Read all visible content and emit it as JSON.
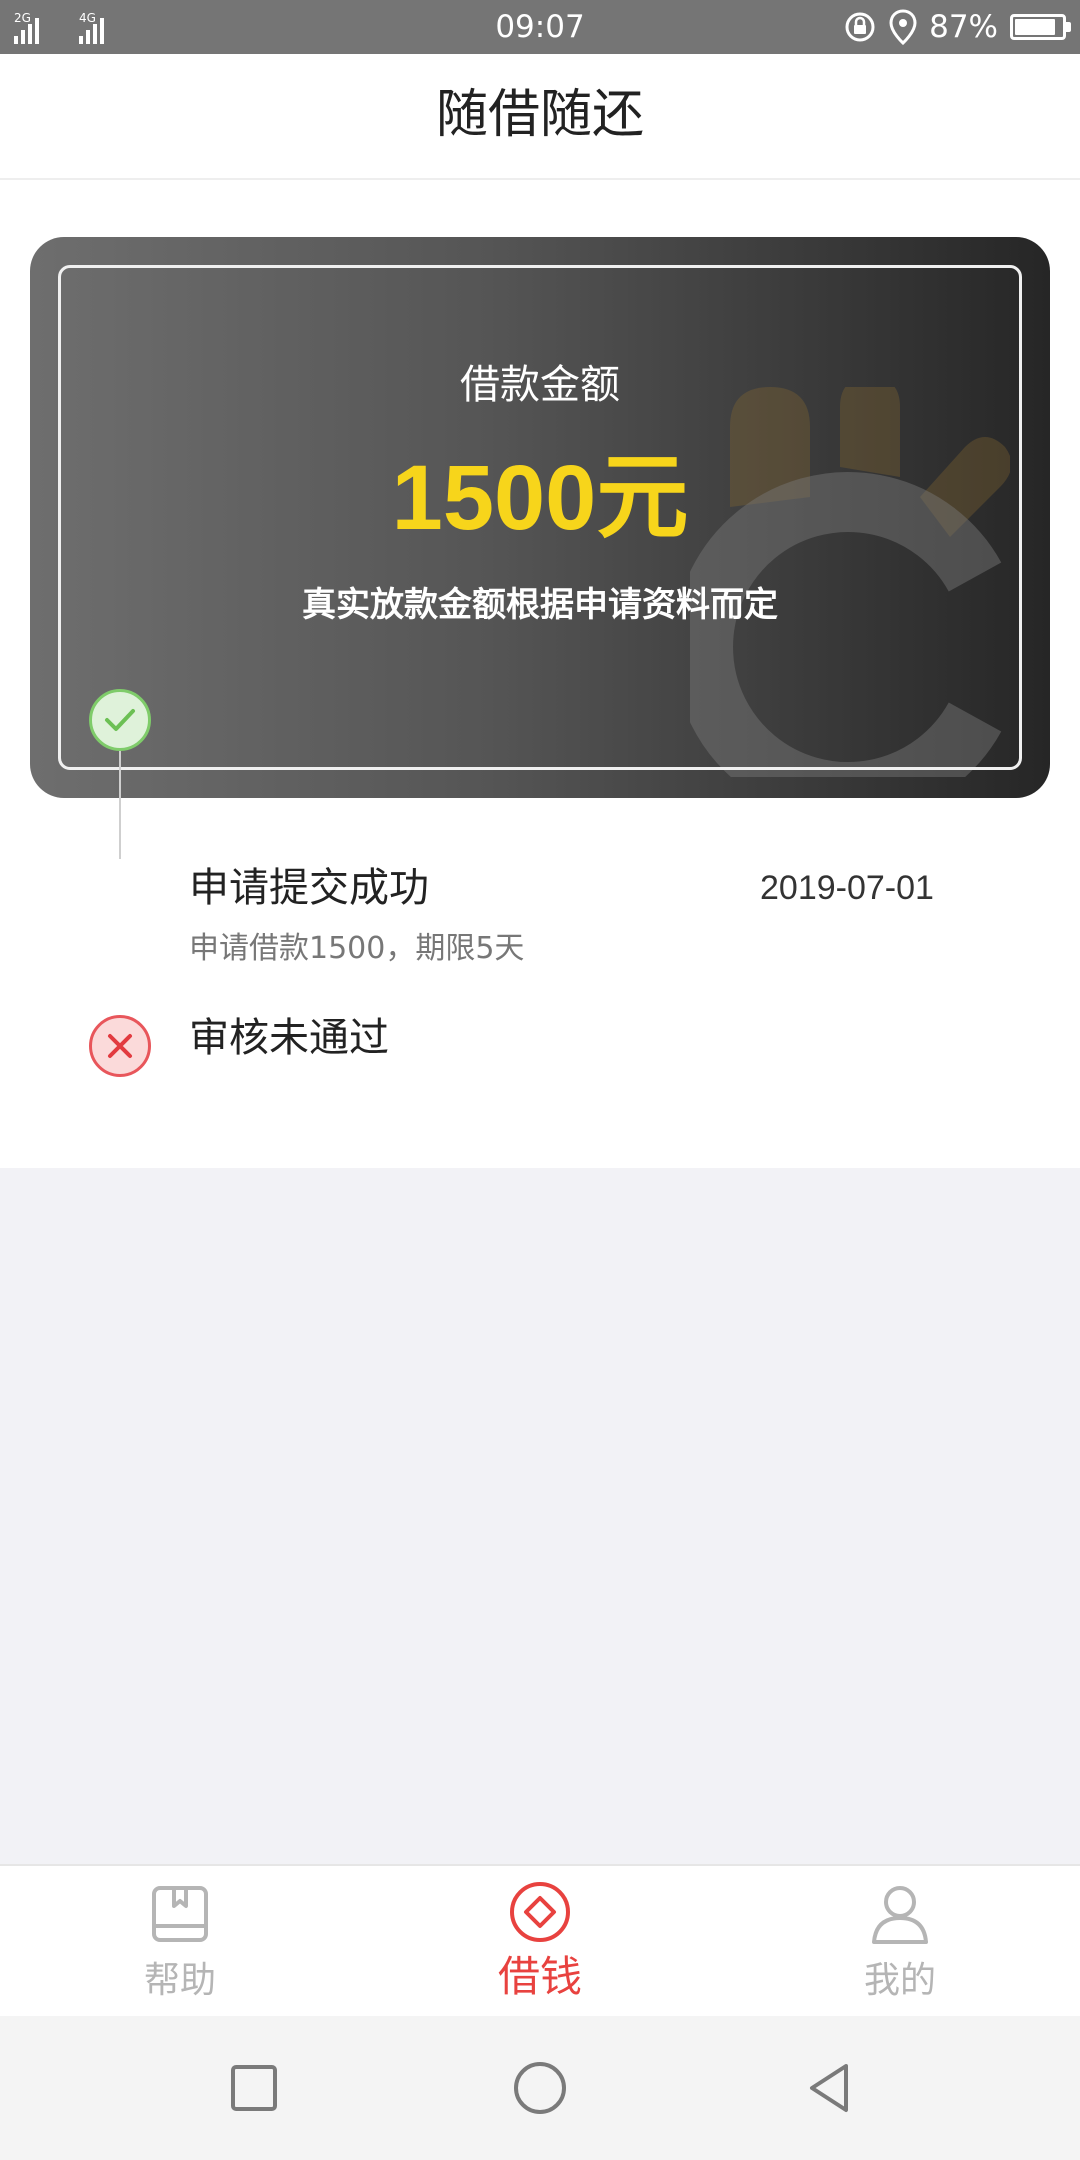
{
  "status_bar": {
    "network_1": "2G",
    "network_2": "4G",
    "time": "09:07",
    "battery_text": "87%",
    "battery_level": 0.87,
    "icons": [
      "rotation-lock-icon",
      "location-icon",
      "battery-icon"
    ]
  },
  "header": {
    "title": "随借随还"
  },
  "loan_card": {
    "label": "借款金额",
    "amount": "1500元",
    "note": "真实放款金额根据申请资料而定",
    "colors": {
      "amount": "#f7d51b",
      "gradient_start": "#6e6e6e",
      "gradient_end": "#262626"
    }
  },
  "timeline": {
    "steps": [
      {
        "title": "申请提交成功",
        "date": "2019-07-01",
        "desc": "申请借款1500，期限5天",
        "status": "success",
        "icon": "check-circle-icon"
      },
      {
        "title": "审核未通过",
        "status": "failed",
        "icon": "x-circle-icon"
      }
    ],
    "colors": {
      "success": "#7fcc6a",
      "failed": "#e8565b"
    }
  },
  "tab_bar": {
    "items": [
      {
        "label": "帮助",
        "icon": "book-icon",
        "active": false
      },
      {
        "label": "借钱",
        "icon": "diamond-coin-icon",
        "active": true
      },
      {
        "label": "我的",
        "icon": "user-icon",
        "active": false
      }
    ],
    "colors": {
      "active": "#e8423f",
      "inactive": "#b5b5b5"
    }
  },
  "nav_bar": {
    "icons": [
      "recent-apps-icon",
      "home-icon",
      "back-icon"
    ]
  }
}
